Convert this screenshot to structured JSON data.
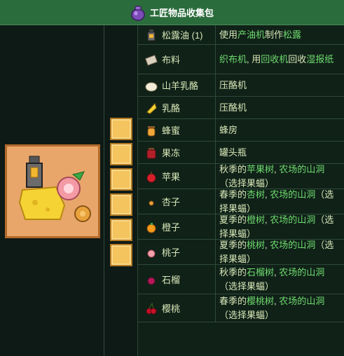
{
  "header": {
    "title": "工匠物品收集包",
    "icon": "purple-bundle-icon"
  },
  "bundle": {
    "icon": "artisan-bundle-picture"
  },
  "slots": {
    "count": 6
  },
  "items": [
    {
      "name": "松露油 (1)",
      "icon": "truffle-oil-icon",
      "source": [
        [
          "使用",
          "p"
        ],
        [
          "产油机",
          "g"
        ],
        [
          "制作",
          "p"
        ],
        [
          "松露",
          "g"
        ]
      ]
    },
    {
      "name": "布料",
      "icon": "cloth-icon",
      "source": [
        [
          "织布机",
          "g"
        ],
        [
          ", 用",
          "p"
        ],
        [
          "回收机",
          "g"
        ],
        [
          "回收",
          "p"
        ],
        [
          "湿报纸",
          "g"
        ]
      ]
    },
    {
      "name": "山羊乳酪",
      "icon": "goat-cheese-icon",
      "source": [
        [
          "压酪机",
          "p"
        ]
      ]
    },
    {
      "name": "乳酪",
      "icon": "cheese-icon",
      "source": [
        [
          "压酪机",
          "p"
        ]
      ]
    },
    {
      "name": "蜂蜜",
      "icon": "honey-icon",
      "source": [
        [
          "蜂房",
          "p"
        ]
      ]
    },
    {
      "name": "果冻",
      "icon": "jelly-icon",
      "source": [
        [
          "罐头瓶",
          "p"
        ]
      ]
    },
    {
      "name": "苹果",
      "icon": "apple-icon",
      "source": [
        [
          "秋季的",
          "p"
        ],
        [
          "苹果树",
          "g"
        ],
        [
          ", ",
          "p"
        ],
        [
          "农场的山洞",
          "g"
        ],
        [
          "（选择果蝠）",
          "p"
        ]
      ]
    },
    {
      "name": "杏子",
      "icon": "apricot-icon",
      "source": [
        [
          "春季的",
          "p"
        ],
        [
          "杏树",
          "g"
        ],
        [
          ", ",
          "p"
        ],
        [
          "农场的山洞",
          "g"
        ],
        [
          "（选择果蝠）",
          "p"
        ]
      ]
    },
    {
      "name": "橙子",
      "icon": "orange-icon",
      "source": [
        [
          "夏季的",
          "p"
        ],
        [
          "橙树",
          "g"
        ],
        [
          ", ",
          "p"
        ],
        [
          "农场的山洞",
          "g"
        ],
        [
          "（选择果蝠）",
          "p"
        ]
      ]
    },
    {
      "name": "桃子",
      "icon": "peach-icon",
      "source": [
        [
          "夏季的",
          "p"
        ],
        [
          "桃树",
          "g"
        ],
        [
          ", ",
          "p"
        ],
        [
          "农场的山洞",
          "g"
        ],
        [
          "（选择果蝠）",
          "p"
        ]
      ]
    },
    {
      "name": "石榴",
      "icon": "pomegranate-icon",
      "source": [
        [
          "秋季的",
          "p"
        ],
        [
          "石榴树",
          "g"
        ],
        [
          ", ",
          "p"
        ],
        [
          "农场的山洞",
          "g"
        ],
        [
          "（选择果蝠）",
          "p"
        ]
      ]
    },
    {
      "name": "樱桃",
      "icon": "cherry-icon",
      "source": [
        [
          "春季的",
          "p"
        ],
        [
          "樱桃树",
          "g"
        ],
        [
          ", ",
          "p"
        ],
        [
          "农场的山洞",
          "g"
        ],
        [
          "（选择果蝠）",
          "p"
        ]
      ]
    }
  ],
  "colors": {
    "header_bg": "#2b6c3d",
    "link": "#6fdc6f",
    "text": "#d8e8b8",
    "slot": "#f4c45e",
    "bundle_bg": "#e8a66a"
  }
}
